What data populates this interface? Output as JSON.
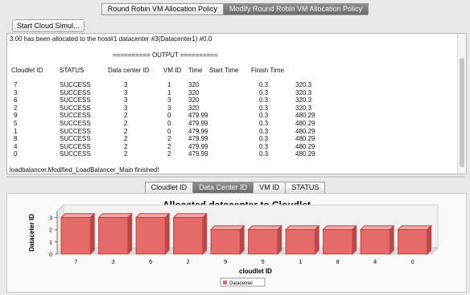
{
  "top_tabs": [
    {
      "label": "Round Robin VM Allocation Policy",
      "selected": false
    },
    {
      "label": "Modify Round Robin VM Allocation Policy",
      "selected": true
    }
  ],
  "start_button": "Start Cloud Simul...",
  "console": {
    "first_line": "3.00 has been allocated to the host#1 datacenter #3(Datacenter1) #0.0",
    "output_header": "========== OUTPUT ==========",
    "columns": [
      "Cloudlet ID",
      "STATUS",
      "Data center ID",
      "VM ID",
      "Time",
      "Start Time",
      "Finish Time"
    ],
    "rows": [
      [
        "7",
        "SUCCESS",
        "3",
        "1",
        "320",
        "0.3",
        "320.3"
      ],
      [
        "3",
        "SUCCESS",
        "3",
        "1",
        "320",
        "0.3",
        "320.3"
      ],
      [
        "6",
        "SUCCESS",
        "3",
        "3",
        "320",
        "0.3",
        "320.3"
      ],
      [
        "2",
        "SUCCESS",
        "3",
        "3",
        "320",
        "0.3",
        "320.3"
      ],
      [
        "9",
        "SUCCESS",
        "2",
        "0",
        "479.99",
        "0.3",
        "480.29"
      ],
      [
        "5",
        "SUCCESS",
        "2",
        "0",
        "479.99",
        "0.3",
        "480.29"
      ],
      [
        "1",
        "SUCCESS",
        "2",
        "0",
        "479.99",
        "0.3",
        "480.29"
      ],
      [
        "8",
        "SUCCESS",
        "2",
        "2",
        "479.99",
        "0.3",
        "480.29"
      ],
      [
        "4",
        "SUCCESS",
        "2",
        "2",
        "479.99",
        "0.3",
        "480.29"
      ],
      [
        "0",
        "SUCCESS",
        "2",
        "2",
        "479.99",
        "0.3",
        "480.29"
      ]
    ],
    "last_line": "loadbalancer.Modified_LoadBalancer_Main finished!"
  },
  "bottom_tabs": [
    {
      "label": "Cloudlet ID",
      "selected": false
    },
    {
      "label": "Data Center ID",
      "selected": true
    },
    {
      "label": "VM ID",
      "selected": false
    },
    {
      "label": "STATUS",
      "selected": false
    }
  ],
  "chart_data": {
    "type": "bar",
    "title": "Allocated datacenter to Cloudlet",
    "xlabel": "cloudlet ID",
    "ylabel": "Dataceter ID",
    "categories": [
      "7",
      "3",
      "6",
      "2",
      "9",
      "5",
      "1",
      "8",
      "4",
      "0"
    ],
    "series": [
      {
        "name": "Datacenter",
        "values": [
          3,
          3,
          3,
          3,
          2,
          2,
          2,
          2,
          2,
          2
        ]
      }
    ],
    "yticks": [
      "0",
      "1",
      "2",
      "3"
    ],
    "ylim": [
      0,
      3.5
    ],
    "bar_color": "#e56b6b",
    "legend": "bottom"
  }
}
